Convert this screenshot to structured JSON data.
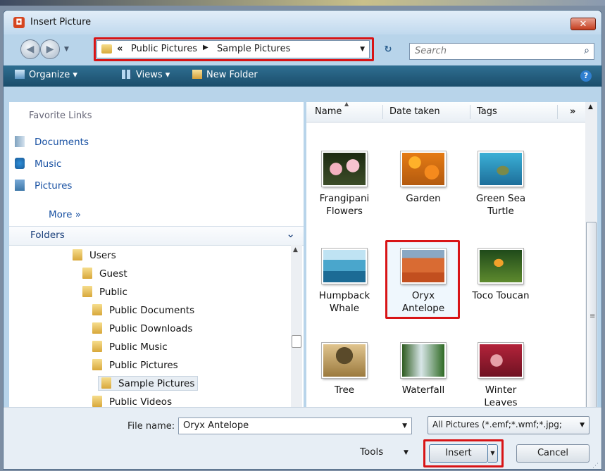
{
  "window": {
    "title": "Insert Picture",
    "close_label": "✕"
  },
  "address": {
    "prefix": "«",
    "segments": [
      "Public Pictures",
      "Sample Pictures"
    ],
    "separator": "▶"
  },
  "search": {
    "placeholder": "Search"
  },
  "toolbar": {
    "organize": "Organize ▾",
    "views": "Views ▾",
    "new_folder": "New Folder",
    "help": "?"
  },
  "favorites": {
    "heading": "Favorite Links",
    "items": [
      "Documents",
      "Music",
      "Pictures"
    ],
    "more": "More »"
  },
  "folders": {
    "label": "Folders",
    "tree": [
      "Users",
      "Guest",
      "Public",
      "Public Documents",
      "Public Downloads",
      "Public Music",
      "Public Pictures",
      "Sample Pictures",
      "Public Videos"
    ],
    "selected": "Sample Pictures"
  },
  "columns": {
    "name": "Name",
    "date": "Date taken",
    "tags": "Tags",
    "more": "»"
  },
  "files": [
    {
      "label1": "Frangipani",
      "label2": "Flowers"
    },
    {
      "label1": "Garden",
      "label2": ""
    },
    {
      "label1": "Green Sea",
      "label2": "Turtle"
    },
    {
      "label1": "Humpback",
      "label2": "Whale"
    },
    {
      "label1": "Oryx",
      "label2": "Antelope"
    },
    {
      "label1": "Toco Toucan",
      "label2": ""
    },
    {
      "label1": "Tree",
      "label2": ""
    },
    {
      "label1": "Waterfall",
      "label2": ""
    },
    {
      "label1": "Winter",
      "label2": "Leaves"
    }
  ],
  "bottom": {
    "file_name_label": "File name:",
    "file_name_value": "Oryx Antelope",
    "file_type": "All Pictures (*.emf;*.wmf;*.jpg;",
    "tools": "Tools",
    "insert": "Insert",
    "cancel": "Cancel"
  },
  "colors": {
    "highlight": "#d81416",
    "toolbar": "#1b4d6b",
    "link": "#1a52a3"
  }
}
